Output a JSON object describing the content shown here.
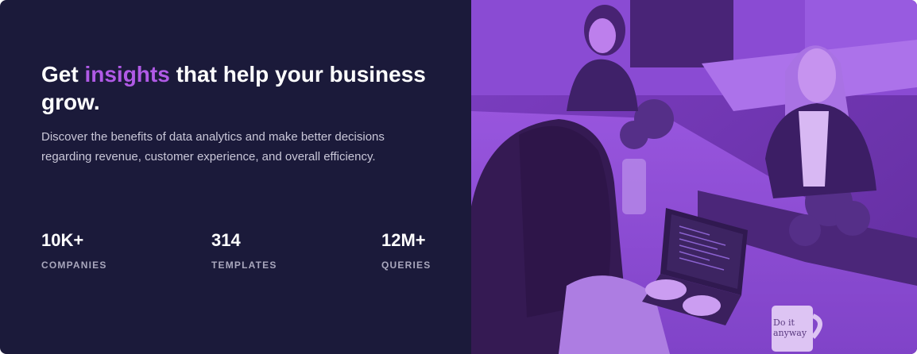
{
  "hero": {
    "title_before": "Get ",
    "title_accent": "insights",
    "title_after": " that help your business grow.",
    "description": "Discover the benefits of data analytics and make better decisions regarding revenue, customer experience, and overall efficiency."
  },
  "stats": [
    {
      "value": "10K+",
      "label": "COMPANIES"
    },
    {
      "value": "314",
      "label": "TEMPLATES"
    },
    {
      "value": "12M+",
      "label": "QUERIES"
    }
  ],
  "photo": {
    "mug_text": "Do it anyway"
  },
  "colors": {
    "background": "#1b1a3a",
    "accent": "#b05ae6",
    "photo_overlay": "#8a3fd1"
  }
}
